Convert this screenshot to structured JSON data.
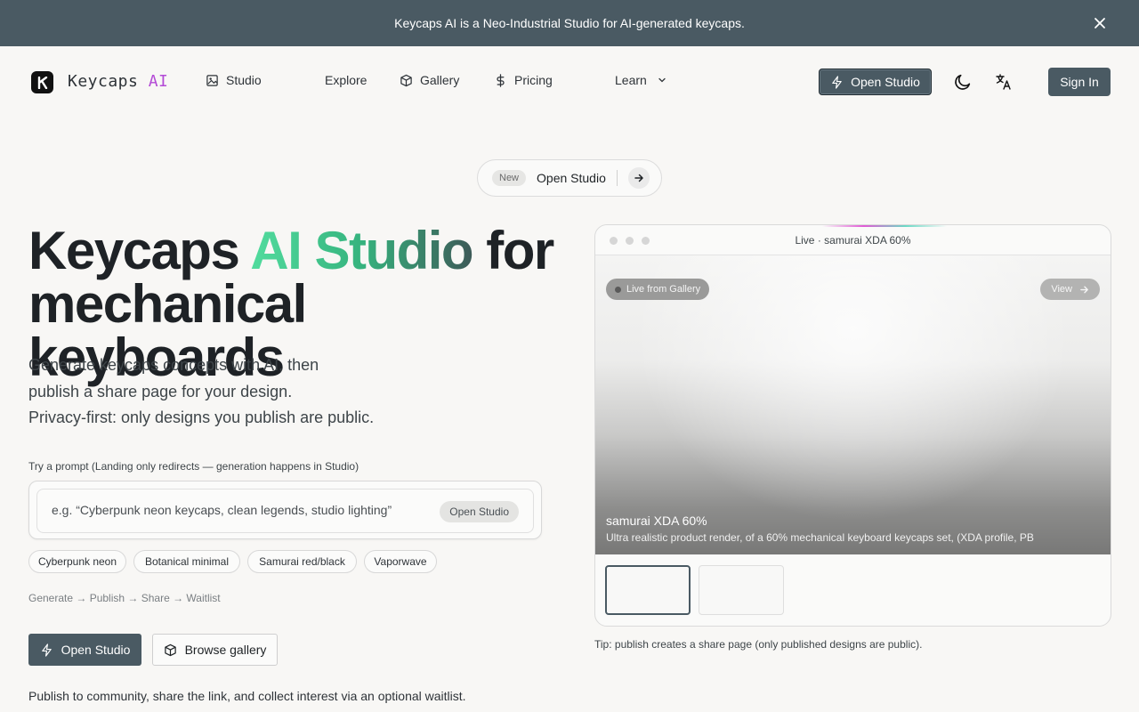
{
  "banner": {
    "text": "Keycaps AI is a Neo-Industrial Studio for AI-generated keycaps."
  },
  "nav": {
    "logo_text_main": "Keycaps ",
    "logo_text_ai": "AI",
    "items": [
      {
        "label": "Studio",
        "icon": "image-icon"
      },
      {
        "label": "Explore"
      },
      {
        "label": "Gallery",
        "icon": "box-icon"
      },
      {
        "label": "Pricing",
        "icon": "dollar-icon"
      },
      {
        "label": "Learn",
        "icon": "chevron-down-icon"
      }
    ],
    "open_studio": "Open Studio",
    "sign_in": "Sign In"
  },
  "pill": {
    "badge": "New",
    "label": "Open Studio"
  },
  "hero": {
    "title_part1": "Keycaps ",
    "title_gradient": "AI Studio",
    "title_part2": " for mechanical keyboards",
    "subtitle_lines": [
      "Generate keycaps concepts with AI, then",
      "publish a share page for your design.",
      "Privacy-first: only designs you publish are public."
    ]
  },
  "prompt": {
    "label": "Try a prompt (Landing only redirects — generation happens in Studio)",
    "placeholder": "e.g. “Cyberpunk neon keycaps, clean legends, studio lighting”",
    "button": "Open Studio",
    "chips": [
      "Cyberpunk neon",
      "Botanical minimal",
      "Samurai red/black",
      "Vaporwave"
    ]
  },
  "flow": "Generate → Publish → Share → Waitlist",
  "cta": {
    "primary": "Open Studio",
    "secondary": "Browse gallery"
  },
  "footnote": "Publish to community, share the link, and collect interest via an optional waitlist.",
  "preview_card": {
    "title": "Live · samurai XDA 60%",
    "live_badge": "Live from Gallery",
    "view": "View",
    "name": "samurai XDA 60%",
    "description": "Ultra realistic product render, of a 60% mechanical keyboard keycaps set, (XDA profile, PB"
  },
  "tip": "Tip: publish creates a share page (only published designs are public).",
  "colors": {
    "primary": "#4a5a63",
    "accent_ai": "#b44bd6",
    "gradient_start": "#52dc9e",
    "gradient_end": "#3d5a58"
  }
}
